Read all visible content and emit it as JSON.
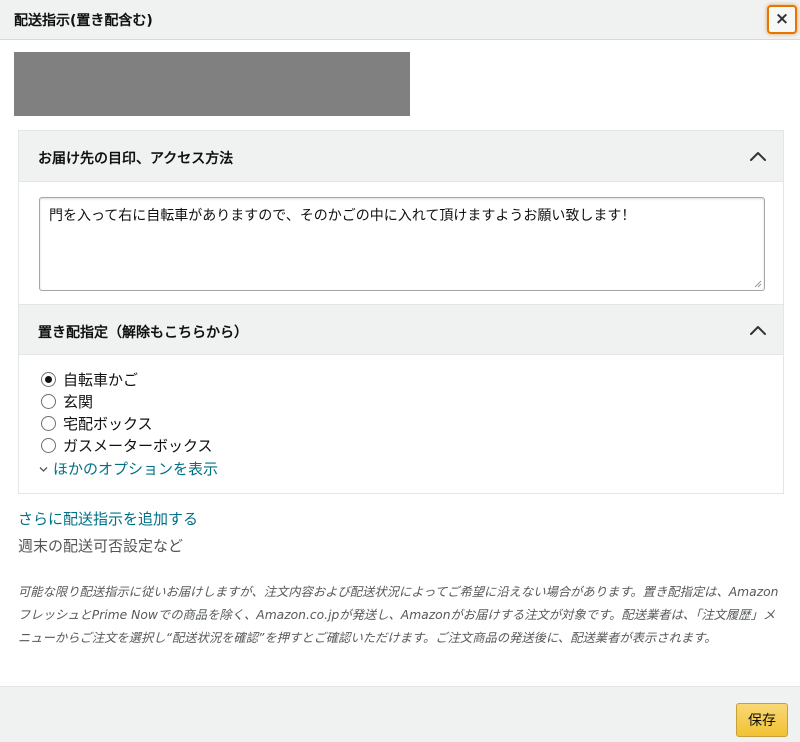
{
  "dialog": {
    "title": "配送指示(置き配含む)",
    "close_label": "×"
  },
  "colors": {
    "link": "#007185",
    "focus_ring": "#e77600",
    "save_button": "#f7ca4b",
    "redacted_block": "#808080"
  },
  "landmark_section": {
    "title": "お届け先の目印、アクセス方法",
    "chevron_icon": "chevron-up-icon",
    "note_value": "門を入って右に自転車がありますので、そのかごの中に入れて頂けますようお願い致します！"
  },
  "placement_section": {
    "title": "置き配指定（解除もこちらから）",
    "chevron_icon": "chevron-up-icon",
    "options": [
      {
        "label": "自転車かご",
        "selected": true
      },
      {
        "label": "玄関",
        "selected": false
      },
      {
        "label": "宅配ボックス",
        "selected": false
      },
      {
        "label": "ガスメーターボックス",
        "selected": false
      }
    ],
    "show_more_label": "ほかのオプションを表示"
  },
  "add_instruction_link": "さらに配送指示を追加する",
  "weekend_settings_text": "週末の配送可否設定など",
  "disclaimer": "可能な限り配送指示に従いお届けしますが、注文内容および配送状況によってご希望に沿えない場合があります。置き配指定は、AmazonフレッシュとPrime Nowでの商品を除く、Amazon.co.jpが発送し、Amazonがお届けする注文が対象です。配送業者は、「注文履歴」メニューからご注文を選択し“配送状況を確認”を押すとご確認いただけます。ご注文商品の発送後に、配送業者が表示されます。",
  "footer": {
    "save_label": "保存"
  }
}
